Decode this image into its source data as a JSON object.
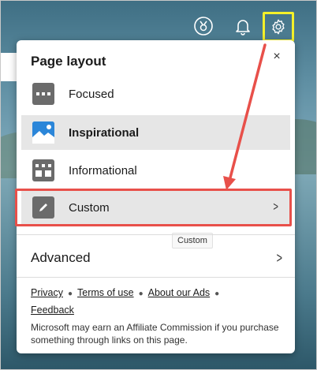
{
  "panel": {
    "title": "Page layout",
    "close_label": "×"
  },
  "layouts": [
    {
      "label": "Focused",
      "icon": "focused-layout-icon"
    },
    {
      "label": "Inspirational",
      "icon": "inspirational-layout-icon",
      "selected": true
    },
    {
      "label": "Informational",
      "icon": "informational-layout-icon"
    },
    {
      "label": "Custom",
      "icon": "pencil-icon"
    }
  ],
  "tooltip": "Custom",
  "advanced": {
    "label": "Advanced"
  },
  "footer": {
    "links": [
      "Privacy",
      "Terms of use",
      "About our Ads",
      "Feedback"
    ],
    "disclaimer": "Microsoft may earn an Affiliate Commission if you purchase something through links on this page."
  },
  "colors": {
    "highlight_yellow": "#f3f02a",
    "annotation_red": "#e8504a",
    "selected_bg": "#e6e6e6"
  }
}
